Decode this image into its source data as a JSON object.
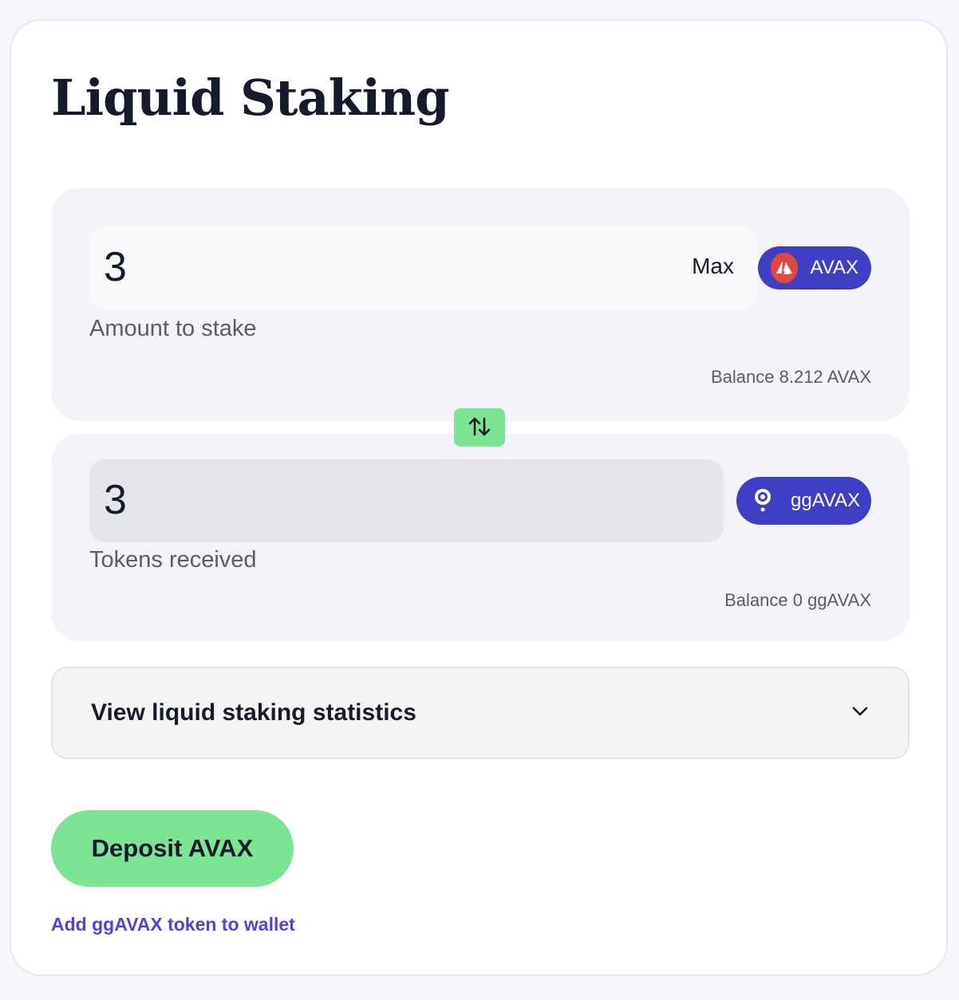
{
  "page": {
    "title": "Liquid Staking"
  },
  "stake": {
    "amount_value": "3",
    "max_label": "Max",
    "token_label": "AVAX",
    "field_label": "Amount to stake",
    "balance_text": "Balance 8.212 AVAX",
    "token_icon": "avax-logo-icon"
  },
  "receive": {
    "amount_value": "3",
    "token_label": "ggAVAX",
    "field_label": "Tokens received",
    "balance_text": "Balance 0 ggAVAX",
    "token_icon": "ggavax-logo-icon"
  },
  "swap": {
    "icon": "swap-arrows-icon"
  },
  "stats": {
    "label": "View liquid staking statistics",
    "icon": "chevron-down-icon"
  },
  "actions": {
    "deposit_label": "Deposit AVAX",
    "add_token_link": "Add ggAVAX token to wallet"
  },
  "colors": {
    "accent_green": "#7ce594",
    "token_pill": "#3f3fc6",
    "avax_red": "#e2473f",
    "link_purple": "#5b3fd8"
  }
}
